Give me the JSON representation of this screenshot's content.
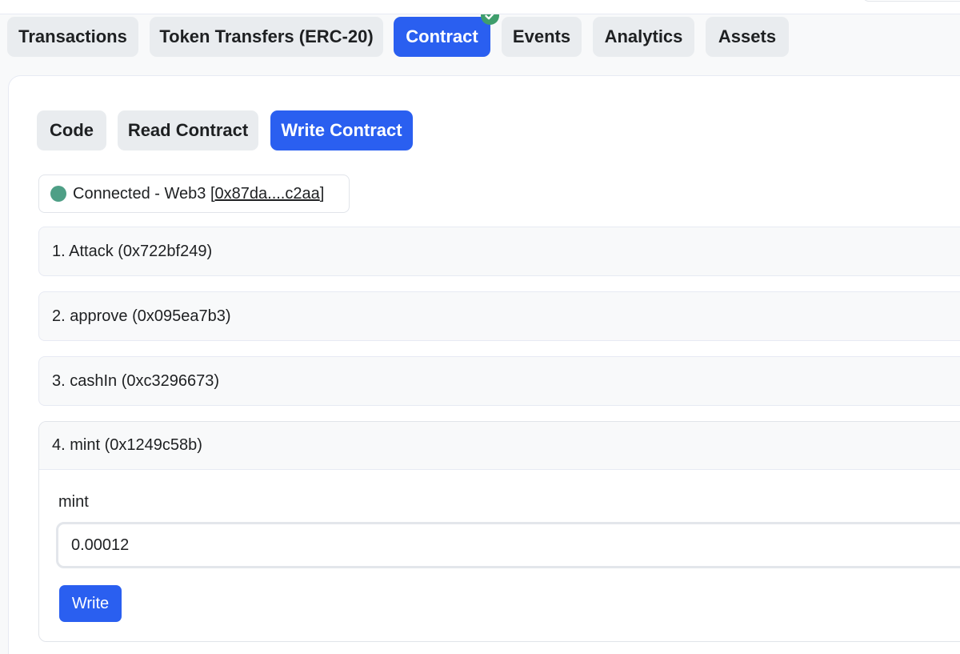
{
  "main_tabs": [
    {
      "label": "Transactions",
      "active": false
    },
    {
      "label": "Token Transfers (ERC-20)",
      "active": false
    },
    {
      "label": "Contract",
      "active": true
    },
    {
      "label": "Events",
      "active": false
    },
    {
      "label": "Analytics",
      "active": false
    },
    {
      "label": "Assets",
      "active": false
    }
  ],
  "contract_tab_badge": "check-icon",
  "sub_tabs": [
    {
      "label": "Code",
      "active": false
    },
    {
      "label": "Read Contract",
      "active": false
    },
    {
      "label": "Write Contract",
      "active": true
    }
  ],
  "connection": {
    "status_text": "Connected - Web3 [",
    "address": "0x87da....c2aa",
    "suffix": "]",
    "status_color": "#4e9f86"
  },
  "functions": [
    {
      "label": "1. Attack (0x722bf249)"
    },
    {
      "label": "2. approve (0x095ea7b3)"
    },
    {
      "label": "3. cashIn (0xc3296673)"
    },
    {
      "label": "4. mint (0x1249c58b)"
    }
  ],
  "mint_form": {
    "param_label": "mint",
    "input_value": "0.00012",
    "write_label": "Write"
  },
  "colors": {
    "accent": "#2a5ff0",
    "verified": "#3f9e6c"
  }
}
